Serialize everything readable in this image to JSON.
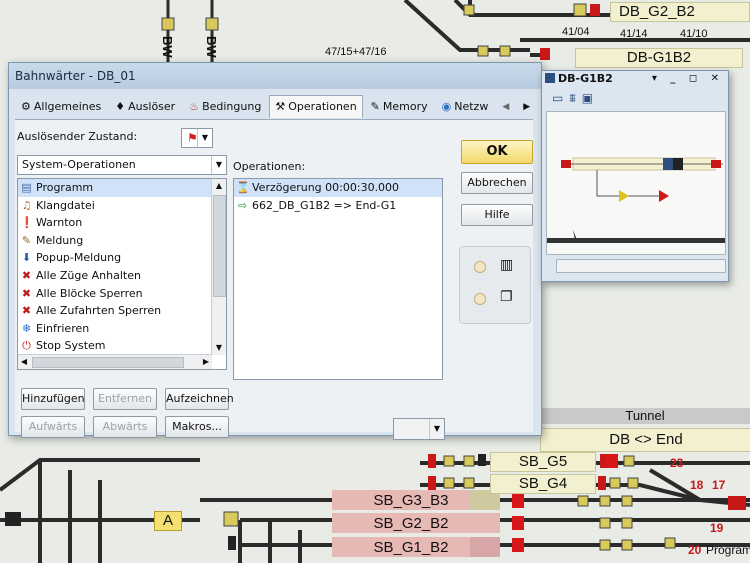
{
  "background": {
    "blocks": {
      "db_g2_b2": "DB_G2_B2",
      "db_g1b2": "DB-G1B2",
      "sb_g5": "SB_G5",
      "sb_g4": "SB_G4",
      "sb_g3_b3": "SB_G3_B3",
      "sb_g2_b2": "SB_G2_B2",
      "sb_g1_b2": "SB_G1_B2",
      "marker_a": "A",
      "tunnel": "Tunnel",
      "db_end": "DB <> End"
    },
    "track_numbers": {
      "t1": "47/15+47/16",
      "t2": "41/04",
      "t3": "41/14",
      "t4": "41/10"
    },
    "vertical_labels": {
      "v1": "BW",
      "v2": "BW"
    },
    "signal_numbers": {
      "s23": "23",
      "s18": "18",
      "s17": "17",
      "s19": "19",
      "s20": "20"
    },
    "program_label": "Program"
  },
  "dialog": {
    "title": "Bahnwärter - DB_01",
    "tabs": [
      {
        "label": "Allgemeines",
        "icon": "gear-icon",
        "glyph": "⚙"
      },
      {
        "label": "Auslöser",
        "icon": "hand-icon",
        "glyph": "♦"
      },
      {
        "label": "Bedingung",
        "icon": "condition-icon",
        "glyph": "♨"
      },
      {
        "label": "Operationen",
        "icon": "operations-icon",
        "glyph": "⚒"
      },
      {
        "label": "Memory",
        "icon": "memory-icon",
        "glyph": "✎"
      },
      {
        "label": "Netzw",
        "icon": "network-icon",
        "glyph": "◉"
      }
    ],
    "trigger_label": "Auslösender Zustand:",
    "category_select": "System-Operationen",
    "operations_label": "Operationen:",
    "available_ops": [
      {
        "label": "Programm",
        "icon": "program-icon",
        "glyph": "▤",
        "color": "#4a6fa5"
      },
      {
        "label": "Klangdatei",
        "icon": "sound-icon",
        "glyph": "♫",
        "color": "#c06020"
      },
      {
        "label": "Warnton",
        "icon": "warning-sound-icon",
        "glyph": "❗",
        "color": "#b01818"
      },
      {
        "label": "Meldung",
        "icon": "message-icon",
        "glyph": "✎",
        "color": "#8a6a20"
      },
      {
        "label": "Popup-Meldung",
        "icon": "popup-icon",
        "glyph": "⬇",
        "color": "#2a5aa8"
      },
      {
        "label": "Alle Züge Anhalten",
        "icon": "stop-trains-icon",
        "glyph": "✖",
        "color": "#c01818"
      },
      {
        "label": "Alle Blöcke Sperren",
        "icon": "lock-blocks-icon",
        "glyph": "✖",
        "color": "#c01818"
      },
      {
        "label": "Alle Zufahrten Sperren",
        "icon": "lock-routes-icon",
        "glyph": "✖",
        "color": "#c01818"
      },
      {
        "label": "Einfrieren",
        "icon": "freeze-icon",
        "glyph": "❄",
        "color": "#2a70c0"
      },
      {
        "label": "Stop System",
        "icon": "stop-system-icon",
        "glyph": "⏻",
        "color": "#d02020"
      },
      {
        "label": "",
        "icon": "more-icon",
        "glyph": "●",
        "color": "#2a9a3a"
      }
    ],
    "configured_ops": [
      {
        "label": "Verzögerung 00:00:30.000",
        "icon": "hourglass-icon",
        "glyph": "⌛",
        "color": "#6a6a6a"
      },
      {
        "label": "662_DB_G1B2 => End-G1",
        "icon": "route-icon",
        "glyph": "⇨",
        "color": "#2a9a3a"
      }
    ],
    "buttons": {
      "ok": "OK",
      "cancel": "Abbrechen",
      "help": "Hilfe",
      "add": "Hinzufügen",
      "remove": "Entfernen",
      "record": "Aufzeichnen",
      "up": "Aufwärts",
      "down": "Abwärts",
      "macros": "Makros..."
    }
  },
  "mini_window": {
    "title": "DB-G1B2",
    "controls": "▾ _ ◻ ✕"
  },
  "colors": {
    "accent": "#f3d86a",
    "block_bg": "#f3f0cf",
    "signal_red": "#d81818"
  }
}
